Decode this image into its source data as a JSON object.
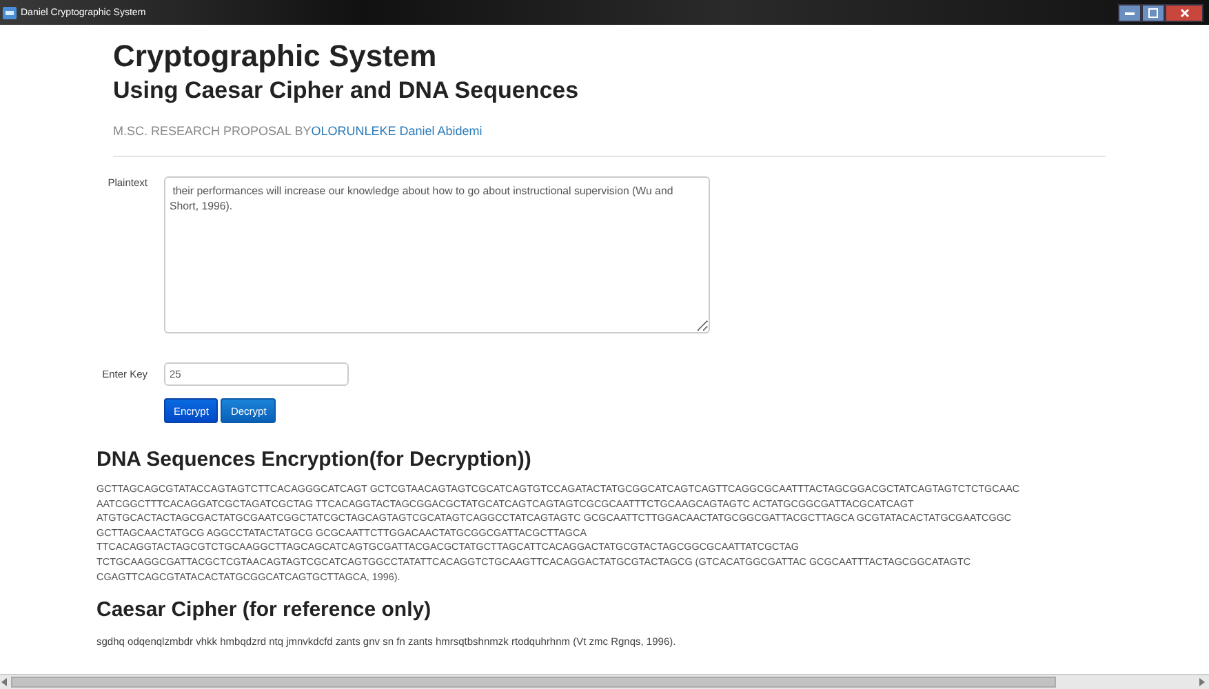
{
  "window": {
    "title": "Daniel Cryptographic System"
  },
  "header": {
    "title": "Cryptographic System",
    "subtitle": "Using Caesar Cipher and DNA Sequences",
    "byline": "M.SC. RESEARCH PROPOSAL BY",
    "author": "OLORUNLEKE Daniel Abidemi"
  },
  "form": {
    "plaintext_label": "Plaintext",
    "plaintext": " their performances will increase our knowledge about how to go about instructional supervision (Wu and Short, 1996).",
    "key_label": "Enter Key",
    "key": "25",
    "buttons": [
      "Encrypt",
      "Decrypt"
    ]
  },
  "dna": {
    "heading": "DNA Sequences Encryption(for Decryption))",
    "lines": [
      "GCTTAGCAGCGTATACCAGTAGTCTTCACAGGGCATCAGT GCTCGTAACAGTAGTCGCATCAGTGTCCAGATACTATGCGGCATCAGTCAGTTCAGGCGCAATTTACTAGCGGACGCTATCAGTAGTCTCTGCAAC",
      "AATCGGCTTTCACAGGATCGCTAGATCGCTAG TTCACAGGTACTAGCGGACGCTATGCATCAGTCAGTAGTCGCGCAATTTCTGCAAGCAGTAGTC ACTATGCGGCGATTACGCATCAGT",
      "ATGTGCACTACTAGCGACTATGCGAATCGGCTATCGCTAGCAGTAGTCGCATAGTCAGGCCTATCAGTAGTC GCGCAATTCTTGGACAACTATGCGGCGATTACGCTTAGCA GCGTATACACTATGCGAATCGGC",
      "GCTTAGCAACTATGCG AGGCCTATACTATGCG GCGCAATTCTTGGACAACTATGCGGCGATTACGCTTAGCA",
      "TTCACAGGTACTAGCGTCTGCAAGGCTTAGCAGCATCAGTGCGATTACGACGCTATGCTTAGCATTCACAGGACTATGCGTACTAGCGGCGCAATTATCGCTAG",
      "TCTGCAAGGCGATTACGCTCGTAACAGTAGTCGCATCAGTGGCCTATATTCACAGGTCTGCAAGTTCACAGGACTATGCGTACTAGCG (GTCACATGGCGATTAC GCGCAATTTACTAGCGGCATAGTC",
      "CGAGTTCAGCGTATACACTATGCGGCATCAGTGCTTAGCA, 1996)."
    ]
  },
  "caesar": {
    "heading": "Caesar Cipher (for reference only)",
    "text": "sgdhq odqenqlzmbdr vhkk hmbqdzrd ntq jmnvkdcfd zants gnv sn fn zants hmrsqtbshnmzk rtodquhrhnm (Vt zmc Rgnqs, 1996)."
  }
}
